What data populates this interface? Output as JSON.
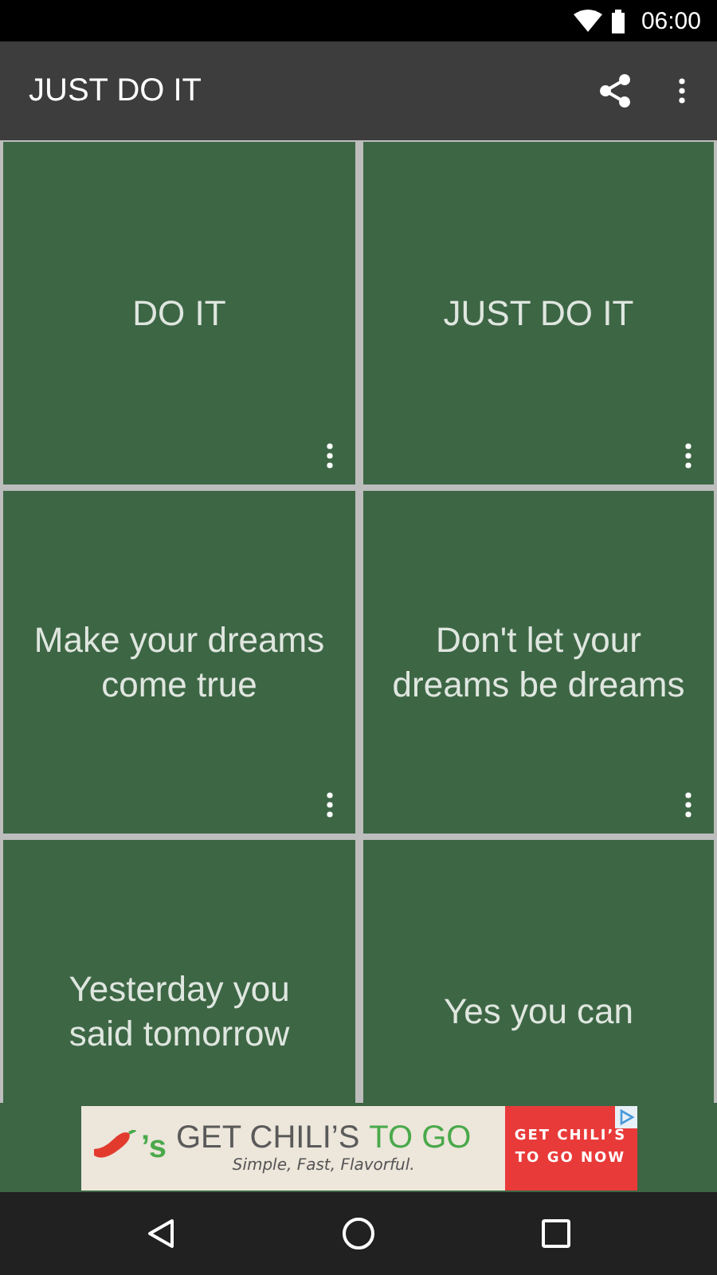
{
  "status_bar": {
    "time": "06:00"
  },
  "app_bar": {
    "title": "JUST DO IT"
  },
  "cards": [
    {
      "text": "DO IT"
    },
    {
      "text": "JUST DO IT"
    },
    {
      "text": "Make your dreams come true"
    },
    {
      "text": "Don't let your dreams be dreams"
    },
    {
      "text": "Yesterday you said tomorrow"
    },
    {
      "text": "Yes you can"
    }
  ],
  "ad": {
    "logo_text": "’s",
    "headline": "GET CHILI’S",
    "headline_accent": "TO GO",
    "tagline": "Simple, Fast, Flavorful.",
    "cta": "GET CHILI’S TO GO NOW"
  }
}
